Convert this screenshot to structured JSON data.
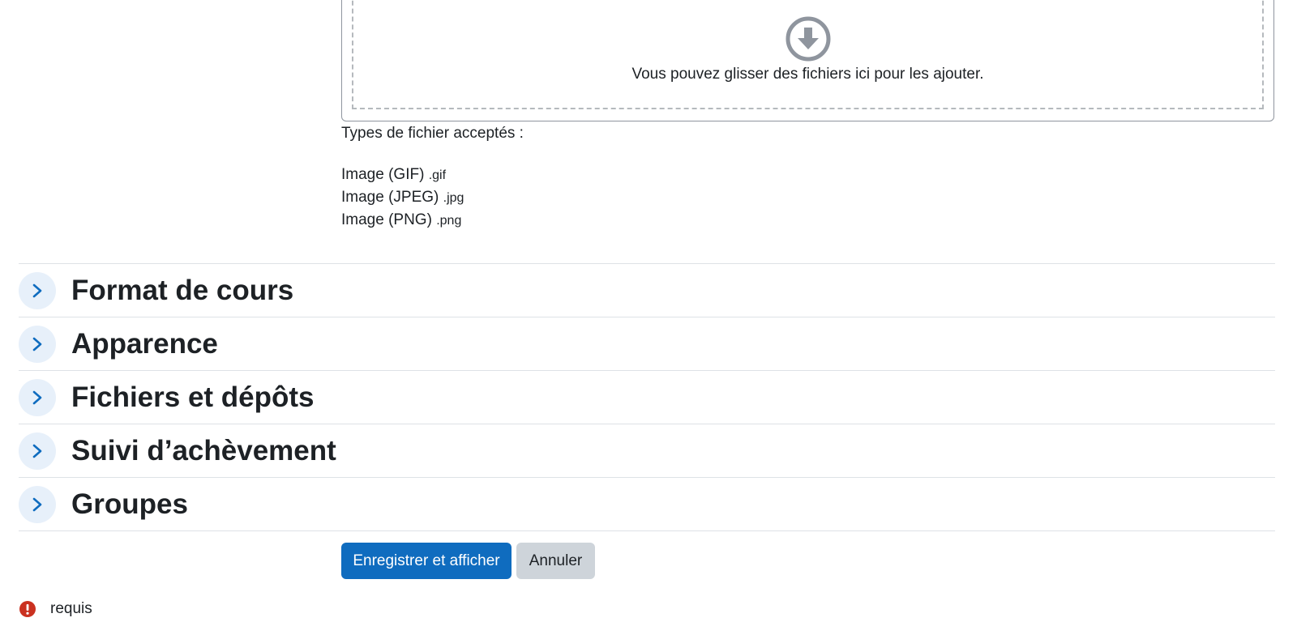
{
  "filemanager": {
    "drop_text": "Vous pouvez glisser des fichiers ici pour les ajouter.",
    "drop_icon": "download-circle-icon"
  },
  "accepted_types": {
    "title": "Types de fichier acceptés :",
    "items": [
      {
        "label": "Image (GIF)",
        "ext": ".gif"
      },
      {
        "label": "Image (JPEG)",
        "ext": ".jpg"
      },
      {
        "label": "Image (PNG)",
        "ext": ".png"
      }
    ]
  },
  "sections": [
    {
      "title": "Format de cours"
    },
    {
      "title": "Apparence"
    },
    {
      "title": "Fichiers et dépôts"
    },
    {
      "title": "Suivi d’achèvement"
    },
    {
      "title": "Groupes"
    }
  ],
  "buttons": {
    "save_label": "Enregistrer et afficher",
    "cancel_label": "Annuler"
  },
  "required": {
    "label": "requis",
    "icon": "exclamation-circle-icon"
  },
  "colors": {
    "primary": "#0f6cbf",
    "secondary": "#ced4da",
    "toggle_bg": "#e7f0fa",
    "required": "#ca3120",
    "text": "#1d2125"
  }
}
